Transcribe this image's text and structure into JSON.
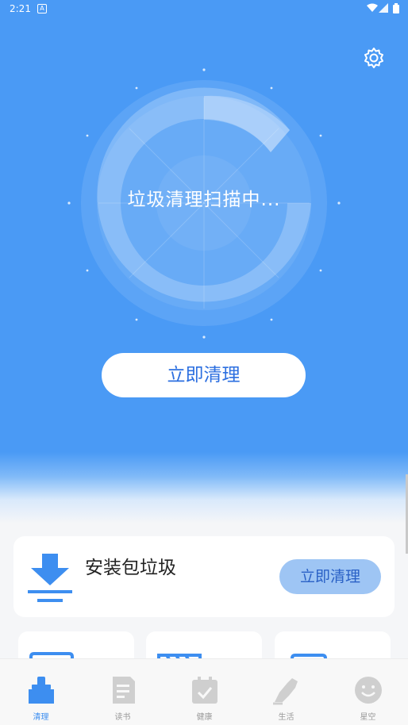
{
  "status_bar": {
    "time": "2:21",
    "notification_icon": "A"
  },
  "scan": {
    "status_text": "垃圾清理扫描中..."
  },
  "hero_button": {
    "label": "立即清理"
  },
  "card": {
    "title": "安装包垃圾",
    "button_label": "立即清理"
  },
  "tabs": [
    {
      "label": "清理",
      "icon": "broom-icon",
      "active": true
    },
    {
      "label": "读书",
      "icon": "book-icon",
      "active": false
    },
    {
      "label": "健康",
      "icon": "calendar-check-icon",
      "active": false
    },
    {
      "label": "生活",
      "icon": "shoe-icon",
      "active": false
    },
    {
      "label": "星空",
      "icon": "smiley-icon",
      "active": false
    }
  ],
  "colors": {
    "primary": "#4a9af5",
    "accent_text": "#2c6fe0",
    "tab_active": "#3d8ef0",
    "tab_inactive": "#9a9a9a"
  }
}
